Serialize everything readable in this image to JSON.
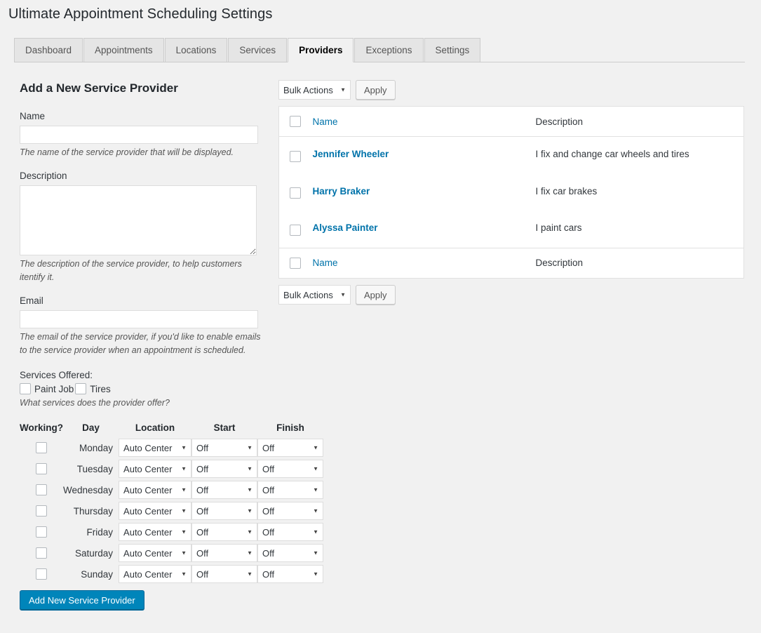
{
  "header": {
    "title": "Ultimate Appointment Scheduling Settings"
  },
  "tabs": [
    {
      "label": "Dashboard",
      "active": false
    },
    {
      "label": "Appointments",
      "active": false
    },
    {
      "label": "Locations",
      "active": false
    },
    {
      "label": "Services",
      "active": false
    },
    {
      "label": "Providers",
      "active": true
    },
    {
      "label": "Exceptions",
      "active": false
    },
    {
      "label": "Settings",
      "active": false
    }
  ],
  "form": {
    "title": "Add a New Service Provider",
    "name": {
      "label": "Name",
      "value": "",
      "placeholder": "",
      "hint": "The name of the service provider that will be displayed."
    },
    "description": {
      "label": "Description",
      "value": "",
      "placeholder": "",
      "hint": "The description of the service provider, to help customers itentify it."
    },
    "email": {
      "label": "Email",
      "value": "",
      "placeholder": "",
      "hint": "The email of the service provider, if you'd like to enable emails to the service provider when an appointment is scheduled."
    },
    "services_offered": {
      "label": "Services Offered:",
      "hint": "What services does the provider offer?",
      "options": [
        {
          "label": "Paint Job",
          "checked": false
        },
        {
          "label": "Tires",
          "checked": false
        }
      ]
    },
    "schedule": {
      "headers": {
        "working": "Working?",
        "day": "Day",
        "location": "Location",
        "start": "Start",
        "finish": "Finish"
      },
      "rows": [
        {
          "day": "Monday",
          "working": false,
          "location": "Auto Center",
          "start": "Off",
          "finish": "Off"
        },
        {
          "day": "Tuesday",
          "working": false,
          "location": "Auto Center",
          "start": "Off",
          "finish": "Off"
        },
        {
          "day": "Wednesday",
          "working": false,
          "location": "Auto Center",
          "start": "Off",
          "finish": "Off"
        },
        {
          "day": "Thursday",
          "working": false,
          "location": "Auto Center",
          "start": "Off",
          "finish": "Off"
        },
        {
          "day": "Friday",
          "working": false,
          "location": "Auto Center",
          "start": "Off",
          "finish": "Off"
        },
        {
          "day": "Saturday",
          "working": false,
          "location": "Auto Center",
          "start": "Off",
          "finish": "Off"
        },
        {
          "day": "Sunday",
          "working": false,
          "location": "Auto Center",
          "start": "Off",
          "finish": "Off"
        }
      ]
    },
    "submit_label": "Add New Service Provider"
  },
  "list": {
    "bulk_actions_label": "Bulk Actions",
    "apply_label": "Apply",
    "columns": {
      "name": "Name",
      "description": "Description"
    },
    "rows": [
      {
        "name": "Jennifer Wheeler",
        "description": "I fix and change car wheels and tires"
      },
      {
        "name": "Harry Braker",
        "description": "I fix car brakes"
      },
      {
        "name": "Alyssa Painter",
        "description": "I paint cars"
      }
    ]
  },
  "colors": {
    "page_background": "#f1f1f1",
    "link": "#0073aa",
    "primary_button": "#0085ba",
    "text": "#32373c",
    "border": "#e1e1e1"
  },
  "icons": {
    "dropdown": "▼"
  }
}
